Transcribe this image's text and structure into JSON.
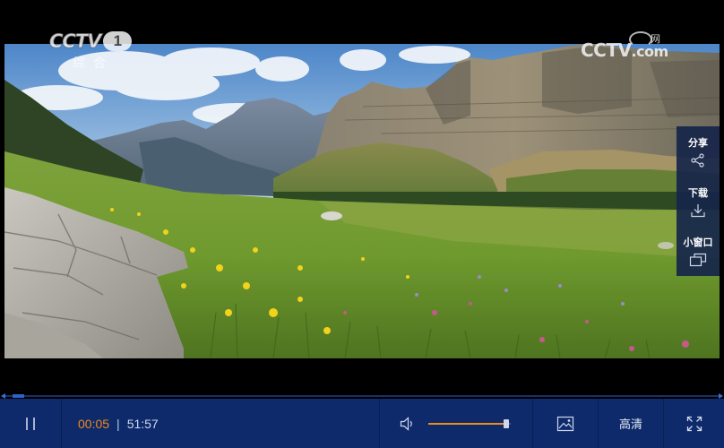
{
  "overlay": {
    "channel_brand": "CCTV",
    "channel_number": "1",
    "channel_sub": "综合",
    "site_brand": "CCTV",
    "site_suffix": ".com",
    "site_mark_char": "网"
  },
  "side_panel": {
    "items": [
      {
        "label": "分享",
        "icon": "share-icon"
      },
      {
        "label": "下载",
        "icon": "download-icon"
      },
      {
        "label": "小窗口",
        "icon": "mini-window-icon"
      }
    ]
  },
  "player": {
    "progress": 0.016,
    "current_time": "00:05",
    "separator": "|",
    "duration": "51:57",
    "volume": 0.95,
    "quality_label": "高清"
  },
  "icons": {
    "pause": "pause-icon",
    "volume": "speaker-icon",
    "snapshot": "image-icon",
    "fullscreen": "fullscreen-icon"
  },
  "colors": {
    "accent": "#f08a1a",
    "bar": "#0e2a6b",
    "panel": "#16254a",
    "progress": "#2f62c8"
  }
}
